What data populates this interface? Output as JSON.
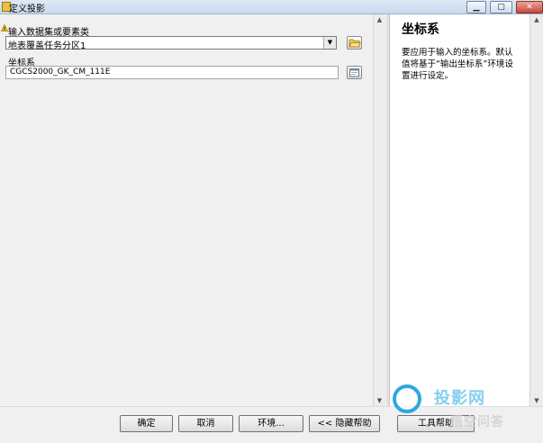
{
  "window": {
    "title": "定义投影",
    "buttons": {
      "minimize": "▁",
      "maximize": "▢",
      "close": "✕"
    }
  },
  "form": {
    "input_label": "输入数据集或要素类",
    "input_value": "地表覆盖任务分区1",
    "crs_label": "坐标系",
    "crs_value": "CGCS2000_GK_CM_111E"
  },
  "help": {
    "title": "坐标系",
    "body": "要应用于输入的坐标系。默认值将基于“输出坐标系”环境设置进行设定。"
  },
  "footer": {
    "ok": "确定",
    "cancel": "取消",
    "environments": "环境...",
    "hide_help": "<< 隐藏帮助",
    "tool_help": "工具帮助"
  },
  "watermark": {
    "top": "投影网",
    "bottom": "悟空问答"
  },
  "icons": {
    "warning": "warning-icon",
    "folder": "open-folder-icon",
    "properties": "spatial-reference-properties-icon",
    "dropdown": "chevron-down-icon"
  },
  "colors": {
    "accent": "#2ea7e0",
    "warning": "#f5c400"
  }
}
